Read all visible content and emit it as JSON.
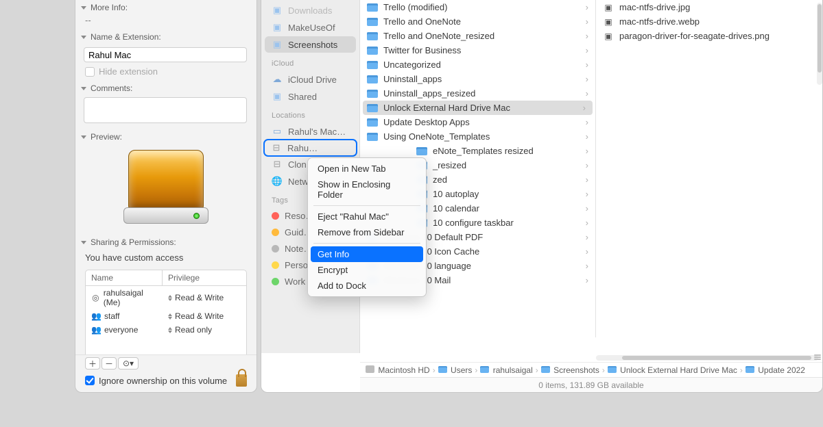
{
  "info": {
    "moreInfo": {
      "label": "More Info:",
      "value": "--"
    },
    "nameExt": {
      "label": "Name & Extension:",
      "value": "Rahul Mac",
      "hideLabel": "Hide extension"
    },
    "comments": {
      "label": "Comments:"
    },
    "preview": {
      "label": "Preview:"
    },
    "sharing": {
      "label": "Sharing & Permissions:",
      "access": "You have custom access"
    },
    "table": {
      "headName": "Name",
      "headPriv": "Privilege",
      "rows": [
        {
          "icon": "user",
          "name": "rahulsaigal (Me)",
          "priv": "Read & Write"
        },
        {
          "icon": "group",
          "name": "staff",
          "priv": "Read & Write"
        },
        {
          "icon": "group",
          "name": "everyone",
          "priv": "Read only"
        }
      ]
    },
    "ignore": "Ignore ownership on this volume"
  },
  "sidebar": {
    "favorites": [
      {
        "name": "Downloads",
        "icon": "folder",
        "dim": true
      },
      {
        "name": "MakeUseOf",
        "icon": "folder"
      },
      {
        "name": "Screenshots",
        "icon": "folder",
        "selected": true
      }
    ],
    "sectionICloud": "iCloud",
    "icloud": [
      {
        "name": "iCloud Drive",
        "icon": "cloud"
      },
      {
        "name": "Shared",
        "icon": "folder"
      }
    ],
    "sectionLocations": "Locations",
    "locations": [
      {
        "name": "Rahul's Mac…",
        "icon": "laptop"
      },
      {
        "name": "Rahul Mac",
        "icon": "drive",
        "highlight": true,
        "truncated": "Rahu…"
      },
      {
        "name": "Clon…",
        "icon": "drive"
      },
      {
        "name": "Netw…",
        "icon": "globe"
      }
    ],
    "sectionTags": "Tags",
    "tags": [
      {
        "name": "Reso…",
        "color": "tag-red"
      },
      {
        "name": "Guid…",
        "color": "tag-orange"
      },
      {
        "name": "Note…",
        "color": "tag-gray"
      },
      {
        "name": "Personal",
        "color": "tag-yellow"
      },
      {
        "name": "Work",
        "color": "tag-green"
      }
    ]
  },
  "col1": [
    {
      "name": "Trello (modified)"
    },
    {
      "name": "Trello and OneNote"
    },
    {
      "name": "Trello and OneNote_resized"
    },
    {
      "name": "Twitter for Business"
    },
    {
      "name": "Uncategorized"
    },
    {
      "name": "Uninstall_apps"
    },
    {
      "name": "Uninstall_apps_resized"
    },
    {
      "name": "Unlock External Hard Drive Mac",
      "selected": true
    },
    {
      "name": "Update Desktop Apps"
    },
    {
      "name": "Using OneNote_Templates"
    },
    {
      "name": "eNote_Templates resized",
      "indent": true
    },
    {
      "name": "_resized",
      "indent": true
    },
    {
      "name": "zed",
      "indent": true
    },
    {
      "name": "10 autoplay",
      "indent": true
    },
    {
      "name": "10 calendar",
      "indent": true
    },
    {
      "name": "10 configure taskbar",
      "indent": true
    },
    {
      "name": "Windows 10 Default PDF"
    },
    {
      "name": "Windows 10 Icon Cache"
    },
    {
      "name": "Windows 10 language"
    },
    {
      "name": "Windows 10 Mail"
    }
  ],
  "col2": [
    {
      "name": "mac-ntfs-drive.jpg",
      "type": "image"
    },
    {
      "name": "mac-ntfs-drive.webp",
      "type": "image"
    },
    {
      "name": "paragon-driver-for-seagate-drives.png",
      "type": "image"
    }
  ],
  "ctx": [
    {
      "label": "Open in New Tab"
    },
    {
      "label": "Show in Enclosing Folder"
    },
    {
      "sep": true
    },
    {
      "label": "Eject \"Rahul Mac\""
    },
    {
      "label": "Remove from Sidebar"
    },
    {
      "sep": true
    },
    {
      "label": "Get Info",
      "selected": true
    },
    {
      "label": "Encrypt"
    },
    {
      "label": "Add to Dock"
    }
  ],
  "path": [
    {
      "label": "Macintosh HD",
      "icon": "hd"
    },
    {
      "label": "Users",
      "icon": "folder"
    },
    {
      "label": "rahulsaigal",
      "icon": "folder"
    },
    {
      "label": "Screenshots",
      "icon": "folder"
    },
    {
      "label": "Unlock External Hard Drive Mac",
      "icon": "folder"
    },
    {
      "label": "Update 2022",
      "icon": "folder"
    }
  ],
  "status": "0 items, 131.89 GB available"
}
